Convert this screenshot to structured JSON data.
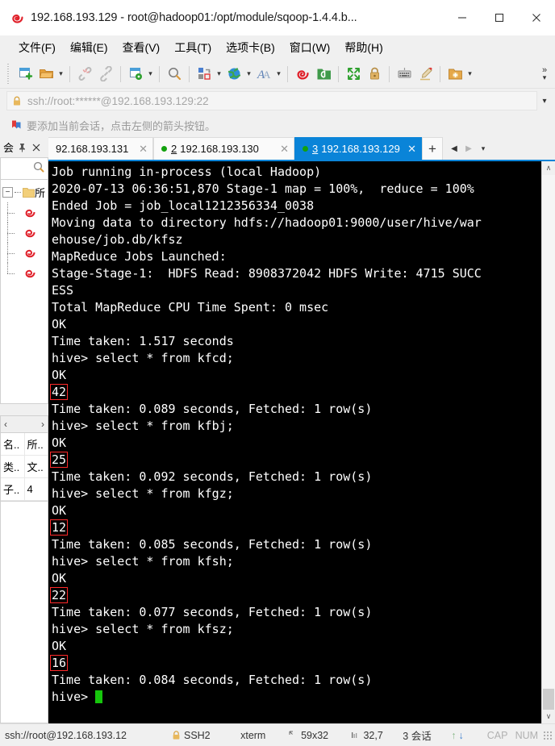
{
  "window": {
    "title": "192.168.193.129 - root@hadoop01:/opt/module/sqoop-1.4.4.b...",
    "logo_icon": "xshell-spiral-icon",
    "minimize_label": "─",
    "maximize_label": "□",
    "close_label": "✕"
  },
  "menu": {
    "items": [
      {
        "label": "文件(F)",
        "name": "menu-file"
      },
      {
        "label": "编辑(E)",
        "name": "menu-edit"
      },
      {
        "label": "查看(V)",
        "name": "menu-view"
      },
      {
        "label": "工具(T)",
        "name": "menu-tools"
      },
      {
        "label": "选项卡(B)",
        "name": "menu-tabs"
      },
      {
        "label": "窗口(W)",
        "name": "menu-window"
      },
      {
        "label": "帮助(H)",
        "name": "menu-help"
      }
    ]
  },
  "toolbar": {
    "overflow_label": "»",
    "caret_label": "▾",
    "items": [
      {
        "name": "new-session-icon"
      },
      {
        "name": "open-session-icon"
      },
      {
        "name": "disconnect-icon"
      },
      {
        "name": "reconnect-icon"
      },
      {
        "name": "session-properties-icon"
      },
      {
        "name": "find-icon"
      },
      {
        "name": "file-transfer-icon"
      },
      {
        "name": "globe-icon"
      },
      {
        "name": "font-icon"
      },
      {
        "name": "xshell-icon"
      },
      {
        "name": "xftp-icon"
      },
      {
        "name": "fullscreen-icon"
      },
      {
        "name": "lock-icon"
      },
      {
        "name": "keyboard-icon"
      },
      {
        "name": "highlight-pen-icon"
      },
      {
        "name": "new-folder-icon"
      }
    ]
  },
  "address": {
    "lock_icon": "lock-icon",
    "value": "ssh://root:******@192.168.193.129:22",
    "placeholder": "ssh://root:******@192.168.193.129:22",
    "dropdown_label": "▾"
  },
  "notice": {
    "icon": "bookmark-flag-icon",
    "text": "要添加当前会话，点击左侧的箭头按钮。"
  },
  "sidebar": {
    "title": "会",
    "pin_icon": "pin-icon",
    "close_icon": "close-icon",
    "search_icon": "search-icon",
    "tree": {
      "expander": "−",
      "root": {
        "label": "所",
        "icon": "folder-icon"
      },
      "children": [
        {
          "label": "",
          "icon": "session-icon"
        },
        {
          "label": "",
          "icon": "session-icon"
        },
        {
          "label": "",
          "icon": "session-icon"
        },
        {
          "label": "",
          "icon": "session-icon"
        }
      ]
    },
    "nav": {
      "prev": "‹",
      "next": "›"
    },
    "properties": [
      {
        "key": "名..",
        "value": "所.."
      },
      {
        "key": "类..",
        "value": "文.."
      },
      {
        "key": "子..",
        "value": "4"
      }
    ]
  },
  "tabs": {
    "items": [
      {
        "name": "tab-193-131",
        "number": "",
        "label": "92.168.193.131",
        "active": false,
        "has_dot": false
      },
      {
        "name": "tab-193-130",
        "number": "2",
        "label": "192.168.193.130",
        "active": false,
        "has_dot": true
      },
      {
        "name": "tab-193-129",
        "number": "3",
        "label": "192.168.193.129",
        "active": true,
        "has_dot": true
      }
    ],
    "close_label": "✕",
    "new_tab_label": "+",
    "nav_prev": "◀",
    "nav_next": "▶",
    "nav_list": "▾"
  },
  "terminal": {
    "lines": [
      {
        "text": "Job running in-process (local Hadoop)"
      },
      {
        "text": "2020-07-13 06:36:51,870 Stage-1 map = 100%,  reduce = 100%"
      },
      {
        "text": "Ended Job = job_local1212356334_0038"
      },
      {
        "text": "Moving data to directory hdfs://hadoop01:9000/user/hive/war"
      },
      {
        "text": "ehouse/job.db/kfsz"
      },
      {
        "text": "MapReduce Jobs Launched:"
      },
      {
        "text": "Stage-Stage-1:  HDFS Read: 8908372042 HDFS Write: 4715 SUCC"
      },
      {
        "text": "ESS"
      },
      {
        "text": "Total MapReduce CPU Time Spent: 0 msec"
      },
      {
        "text": "OK"
      },
      {
        "text": "Time taken: 1.517 seconds"
      },
      {
        "text": "hive> select * from kfcd;"
      },
      {
        "text": "OK"
      },
      {
        "text": "42",
        "boxed": true
      },
      {
        "text": "Time taken: 0.089 seconds, Fetched: 1 row(s)"
      },
      {
        "text": "hive> select * from kfbj;"
      },
      {
        "text": "OK"
      },
      {
        "text": "25",
        "boxed": true
      },
      {
        "text": "Time taken: 0.092 seconds, Fetched: 1 row(s)"
      },
      {
        "text": "hive> select * from kfgz;"
      },
      {
        "text": "OK"
      },
      {
        "text": "12",
        "boxed": true
      },
      {
        "text": "Time taken: 0.085 seconds, Fetched: 1 row(s)"
      },
      {
        "text": "hive> select * from kfsh;"
      },
      {
        "text": "OK"
      },
      {
        "text": "22",
        "boxed": true
      },
      {
        "text": "Time taken: 0.077 seconds, Fetched: 1 row(s)"
      },
      {
        "text": "hive> select * from kfsz;"
      },
      {
        "text": "OK"
      },
      {
        "text": "16",
        "boxed": true
      },
      {
        "text": "Time taken: 0.084 seconds, Fetched: 1 row(s)"
      },
      {
        "text": "hive> ",
        "cursor": true
      }
    ],
    "scroll_up": "∧",
    "scroll_down": "∨",
    "highlight_color": "#ff2a2a",
    "cursor_color": "#16c60c",
    "background": "#000000",
    "foreground": "#ffffff"
  },
  "statusbar": {
    "path": "ssh://root@192.168.193.12",
    "protocol": "SSH2",
    "protocol_icon": "lock-icon",
    "terminal_type": "xterm",
    "size": "59x32",
    "size_icon": "size-icon",
    "position": "32,7",
    "position_icon": "cursor-pos-icon",
    "sessions": "3 会话",
    "up_arrow": "↑",
    "down_arrow": "↓",
    "cap": "CAP",
    "num": "NUM"
  }
}
